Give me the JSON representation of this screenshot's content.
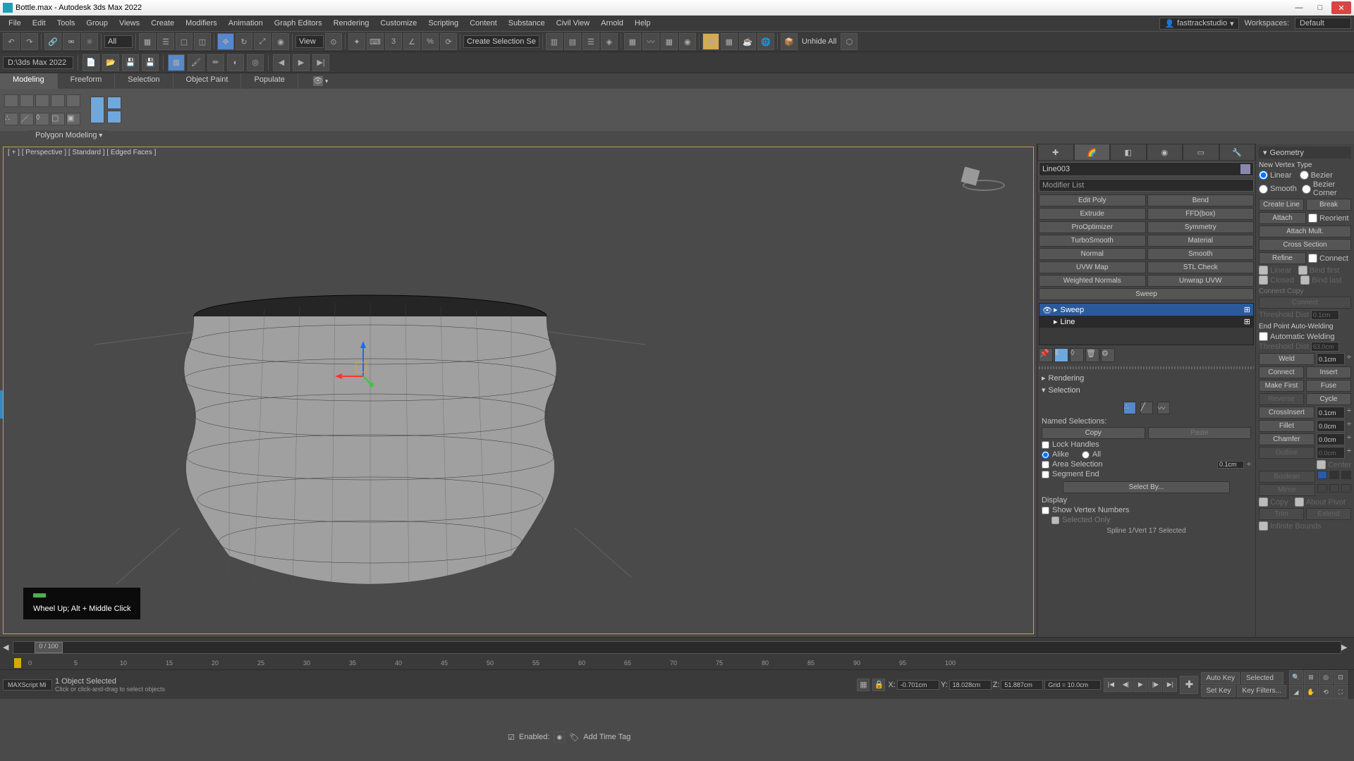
{
  "titlebar": {
    "title": "Bottle.max - Autodesk 3ds Max 2022"
  },
  "menus": [
    "File",
    "Edit",
    "Tools",
    "Group",
    "Views",
    "Create",
    "Modifiers",
    "Animation",
    "Graph Editors",
    "Rendering",
    "Customize",
    "Scripting",
    "Content",
    "Substance",
    "Civil View",
    "Arnold",
    "Help"
  ],
  "login": "fasttrackstudio",
  "workspace": {
    "label": "Workspaces:",
    "value": "Default"
  },
  "toolbar": {
    "all": "All",
    "view": "View",
    "sel_label": "Create Selection Se",
    "unhide": "Unhide All"
  },
  "sub_toolbar": {
    "path": "D:\\3ds Max 2022"
  },
  "ribbon": {
    "tabs": [
      "Modeling",
      "Freeform",
      "Selection",
      "Object Paint",
      "Populate"
    ],
    "section": "Polygon Modeling"
  },
  "viewport": {
    "label": "[ + ] [ Perspective ] [ Standard ] [ Edged Faces ]",
    "overlay": "Wheel Up; Alt + Middle Click"
  },
  "command_panel": {
    "object_name": "Line003",
    "mod_list": "Modifier List",
    "buttons": [
      "Edit Poly",
      "Bend",
      "Extrude",
      "FFD(box)",
      "ProOptimizer",
      "Symmetry",
      "TurboSmooth",
      "Material",
      "Normal",
      "Smooth",
      "UVW Map",
      "STL Check",
      "Weighted Normals",
      "Unwrap UVW",
      "Sweep"
    ],
    "stack": [
      {
        "name": "Sweep"
      },
      {
        "name": "Line"
      }
    ],
    "rollouts": {
      "rendering": "Rendering",
      "selection": "Selection"
    },
    "named_sel": "Named Selections:",
    "copy": "Copy",
    "paste": "Paste",
    "lock_handles": "Lock Handles",
    "alike": "Alike",
    "all": "All",
    "area_sel": "Area Selection",
    "area_val": "0.1cm",
    "segment_end": "Segment End",
    "select_by": "Select By...",
    "display": "Display",
    "show_vertex": "Show Vertex Numbers",
    "selected_only": "Selected Only",
    "status": "Spline 1/Vert 17 Selected"
  },
  "geometry": {
    "header": "Geometry",
    "new_vertex": "New Vertex Type",
    "linear": "Linear",
    "bezier": "Bezier",
    "smooth": "Smooth",
    "bezier_corner": "Bezier Corner",
    "create_line": "Create Line",
    "break": "Break",
    "attach": "Attach",
    "reorient": "Reorient",
    "attach_mult": "Attach Mult.",
    "cross_section": "Cross Section",
    "refine": "Refine",
    "connect": "Connect",
    "linear_cb": "Linear",
    "bind_first": "Bind first",
    "closed": "Closed",
    "bind_last": "Bind last",
    "connect_copy": "Connect Copy",
    "connect2": "Connect",
    "threshold": "Threshold Dist",
    "threshold_val": "0.1cm",
    "end_point": "End Point Auto-Welding",
    "auto_weld": "Automatic Welding",
    "threshold2_val": "63.0cm",
    "weld": "Weld",
    "weld_val": "0.1cm",
    "connect_b": "Connect",
    "insert": "Insert",
    "make_first": "Make First",
    "fuse": "Fuse",
    "reverse": "Reverse",
    "cycle": "Cycle",
    "cross_insert": "CrossInsert",
    "cross_val": "0.1cm",
    "fillet": "Fillet",
    "fillet_val": "0.0cm",
    "chamfer": "Chamfer",
    "chamfer_val": "0.0cm",
    "outline": "Outline",
    "outline_val": "0.0cm",
    "center": "Center",
    "boolean": "Boolean",
    "mirror": "Mirror",
    "copy_cb": "Copy",
    "about_pivot": "About Pivot",
    "trim": "Trim",
    "extend": "Extend",
    "infinite": "Infinite Bounds"
  },
  "timeline": {
    "frame": "0 / 100",
    "ticks": [
      "0",
      "5",
      "10",
      "15",
      "20",
      "25",
      "30",
      "35",
      "40",
      "45",
      "50",
      "55",
      "60",
      "65",
      "70",
      "75",
      "80",
      "85",
      "90",
      "95",
      "100"
    ]
  },
  "statusbar": {
    "script": "MAXScript Mi",
    "sel": "1 Object Selected",
    "prompt": "Click or click-and-drag to select objects",
    "x": "-0.701cm",
    "y": "18.028cm",
    "z": "51.887cm",
    "grid": "Grid = 10.0cm",
    "enabled": "Enabled:",
    "add_tag": "Add Time Tag",
    "auto_key": "Auto Key",
    "selected": "Selected",
    "set_key": "Set Key",
    "key_filters": "Key Filters..."
  }
}
